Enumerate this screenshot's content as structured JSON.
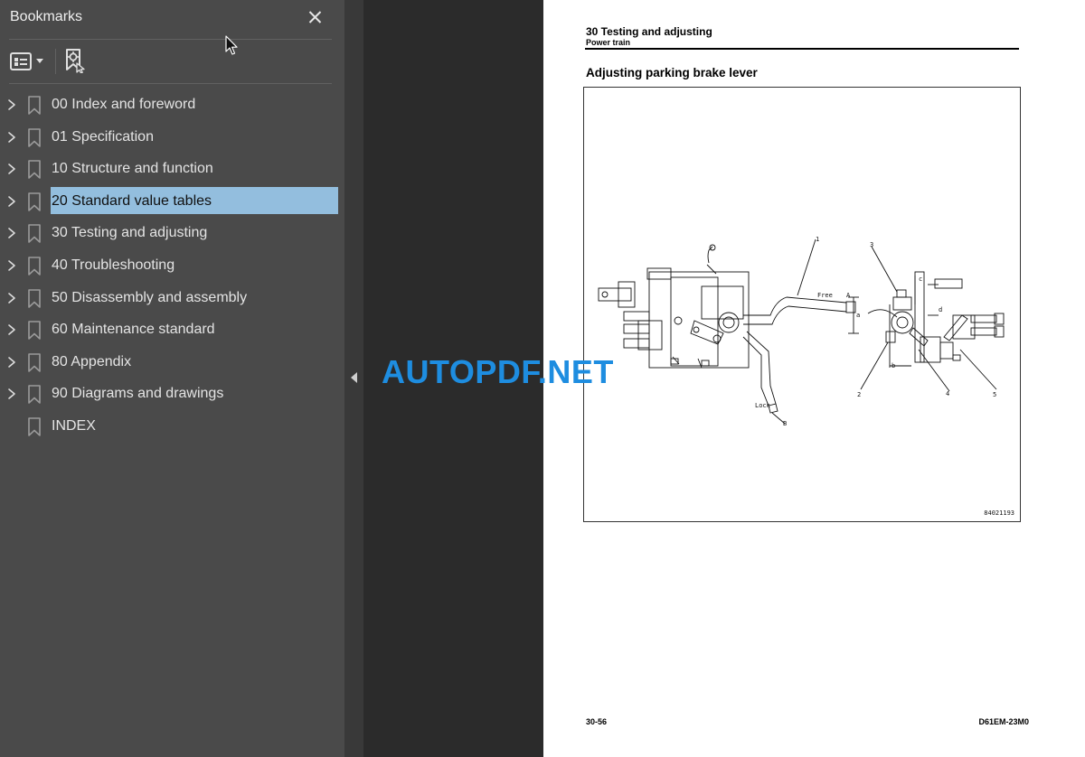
{
  "sidebar": {
    "title": "Bookmarks",
    "close_icon": "close-icon",
    "options_icon": "bookmark-options-icon",
    "find_icon": "find-current-bookmark-icon",
    "items": [
      {
        "label": "00 Index and foreword",
        "expandable": true,
        "selected": false
      },
      {
        "label": "01 Specification",
        "expandable": true,
        "selected": false
      },
      {
        "label": "10 Structure and function",
        "expandable": true,
        "selected": false
      },
      {
        "label": "20 Standard value tables",
        "expandable": true,
        "selected": true
      },
      {
        "label": "30 Testing and adjusting",
        "expandable": true,
        "selected": false
      },
      {
        "label": "40 Troubleshooting",
        "expandable": true,
        "selected": false
      },
      {
        "label": "50 Disassembly and assembly",
        "expandable": true,
        "selected": false
      },
      {
        "label": "60 Maintenance standard",
        "expandable": true,
        "selected": false
      },
      {
        "label": "80 Appendix",
        "expandable": true,
        "selected": false
      },
      {
        "label": "90 Diagrams and drawings",
        "expandable": true,
        "selected": false
      },
      {
        "label": "INDEX",
        "expandable": false,
        "selected": false
      }
    ]
  },
  "page": {
    "chapter": "30 Testing and adjusting",
    "section": "Power train",
    "heading": "Adjusting parking brake lever",
    "figure_labels": {
      "free": "Free",
      "lock": "Lock",
      "a_upper": "A",
      "b_lower": "B",
      "dim_a": "a",
      "dim_b": "b",
      "dim_c": "c",
      "dim_d": "d",
      "callout_1": "1",
      "callout_2": "2",
      "callout_3": "3",
      "callout_4": "4",
      "callout_5": "5"
    },
    "figure_id": "84021193",
    "page_number": "30-56",
    "doc_code": "D61EM-23M0"
  },
  "watermark": "AUTOPDF.NET",
  "colors": {
    "sidebar_bg": "#4a4a4a",
    "selection": "#93bede",
    "watermark": "#1e8de0",
    "page": "#ffffff",
    "canvas": "#2b2b2b"
  }
}
